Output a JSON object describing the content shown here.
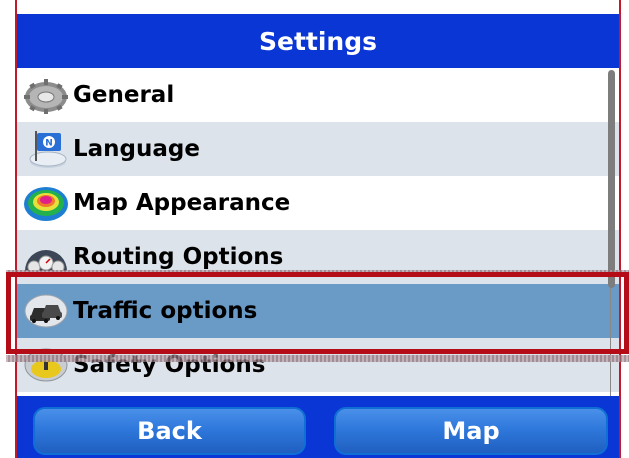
{
  "header": {
    "title": "Settings"
  },
  "menu": {
    "items": [
      {
        "label": "General",
        "icon": "gear-icon"
      },
      {
        "label": "Language",
        "icon": "flag-icon"
      },
      {
        "label": "Map Appearance",
        "icon": "color-palette-icon"
      },
      {
        "label": "Routing Options",
        "icon": "gauges-icon"
      },
      {
        "label": "Traffic options",
        "icon": "traffic-cars-icon",
        "selected": true
      },
      {
        "label": "Safety Options",
        "icon": "warning-icon"
      }
    ]
  },
  "footer": {
    "back_label": "Back",
    "map_label": "Map"
  },
  "colors": {
    "header_bg": "#0a36d6",
    "selected_row": "#6a9ac6",
    "alt_row": "#dde3ea",
    "highlight": "#b50d18"
  }
}
